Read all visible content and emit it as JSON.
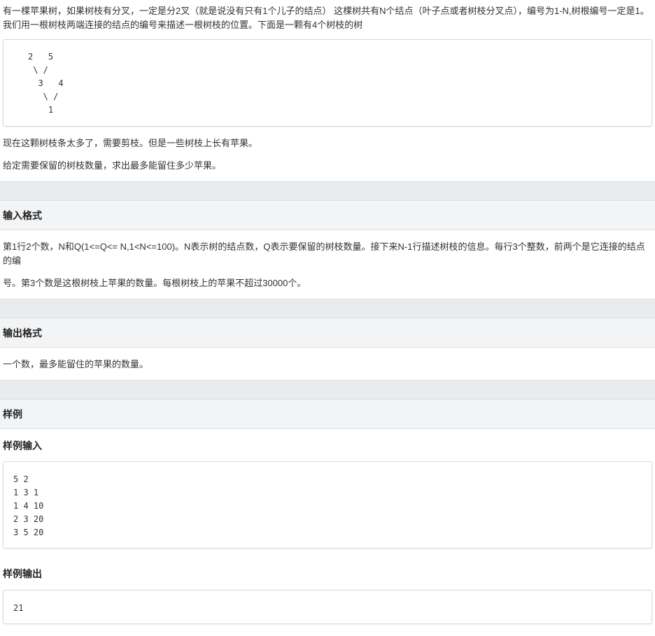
{
  "description": {
    "intro": "有一棵苹果树，如果树枝有分叉，一定是分2叉（就是说没有只有1个儿子的结点） 这棵树共有N个结点（叶子点或者树枝分叉点），编号为1-N,树根编号一定是1。 我们用一根树枝两端连接的结点的编号来描述一根树枝的位置。下面是一颗有4个树枝的树",
    "tree_diagram": "2   5\n \\ /\n  3   4\n   \\ /\n    1",
    "para1": "现在这颗树枝条太多了，需要剪枝。但是一些树枝上长有苹果。",
    "para2": "给定需要保留的树枝数量，求出最多能留住多少苹果。"
  },
  "input_section": {
    "title": "输入格式",
    "para1": "第1行2个数，N和Q(1<=Q<= N,1<N<=100)。N表示树的结点数，Q表示要保留的树枝数量。接下来N-1行描述树枝的信息。每行3个整数，前两个是它连接的结点的编",
    "para2": "号。第3个数是这根树枝上苹果的数量。每根树枝上的苹果不超过30000个。"
  },
  "output_section": {
    "title": "输出格式",
    "para1": "一个数，最多能留住的苹果的数量。"
  },
  "sample_section": {
    "title": "样例",
    "input_label": "样例输入",
    "input_code": "5 2\n1 3 1\n1 4 10\n2 3 20\n3 5 20",
    "output_label": "样例输出",
    "output_code": "21"
  }
}
